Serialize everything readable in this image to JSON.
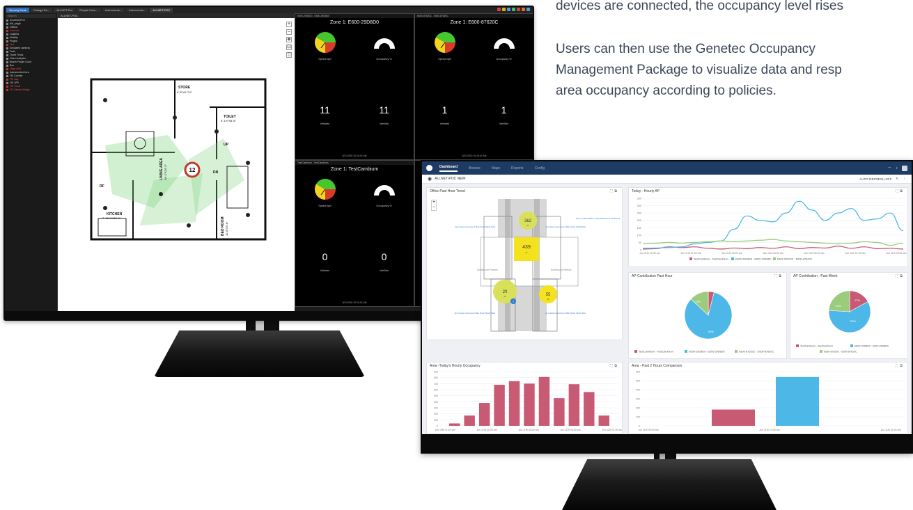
{
  "marketing": {
    "line1": "devices are connected, the occupancy level rises",
    "p2_line1": "Users can then use the Genetec Occupancy",
    "p2_line2": "Management Package to visualize data and resp",
    "p2_line3": "area occupancy according to policies."
  },
  "security_desk": {
    "tabs": [
      "Security Desk",
      "Change Re...",
      "ALLNET-Poc",
      "People Coun...",
      "Instruments...",
      "Instruments...",
      "ALLNET-POC"
    ],
    "tray_colors": [
      "#d94040",
      "#e0b000",
      "#4a9ee0",
      "#40c060",
      "#d94040",
      "#e07020",
      "#4a9ee0"
    ],
    "search_placeholder": "Search",
    "tree": [
      {
        "label": "SmartCityPOC",
        "red": false
      },
      {
        "label": "AM_plugin",
        "red": false
      },
      {
        "label": "Ottawa",
        "red": false
      },
      {
        "label": "Cameras",
        "red": true
      },
      {
        "label": "Logistics",
        "red": false
      },
      {
        "label": "Mobility",
        "red": false
      },
      {
        "label": "Plugins",
        "red": false
      },
      {
        "label": "Test",
        "red": true
      },
      {
        "label": "Simulated cameras",
        "red": false
      },
      {
        "label": "Tools",
        "red": false
      },
      {
        "label": "Travel Times",
        "red": false
      },
      {
        "label": "Video Analytics",
        "red": false
      },
      {
        "label": "Beach People Count",
        "red": false
      },
      {
        "label": "Bus",
        "red": false
      },
      {
        "label": "Other APN",
        "red": true
      },
      {
        "label": "Instrumented Area",
        "red": false
      },
      {
        "label": "TEI Corridor",
        "red": false
      },
      {
        "label": "TEI Italy",
        "red": true
      },
      {
        "label": "TEI LPR",
        "red": false
      },
      {
        "label": "TEI Oneal",
        "red": true
      },
      {
        "label": "TEI Saleem Bridge",
        "red": true
      }
    ],
    "map_header": "ALLNET-POC",
    "map_tools": [
      "+",
      "–",
      "◈",
      "⊡",
      "▯"
    ],
    "floorplan": {
      "store": "STORE",
      "store_dim": "6'-8\"X8'-7½\"",
      "toilet": "TOILET",
      "toilet_dim": "6'-1½\"X8'-8\"",
      "living": "LIVING AREA",
      "living_dim": "28'-2\"X15'-5\"",
      "kitchen": "KITCHEN",
      "kitchen_dim": "7'-10½\"X10'-2\"",
      "bedroom": "BED ROOM",
      "bedroom_dim": "11'-8\"X9'-8\"",
      "dn": "DN",
      "up": "UP",
      "rf": "RF",
      "count": "12"
    },
    "tiles": [
      {
        "head": "E600-29D8D0 - E600-29D8D0",
        "title": "Zone 1: E600-29D8D0",
        "speed_label": "Speed mph",
        "occ_label": "Occupancy %",
        "occ_value": "0",
        "left_num": "11",
        "left_label": "Vehicles",
        "right_num": "11",
        "right_label": "Veh/Min",
        "date": "6/11/2020 10:20:42 AM"
      },
      {
        "head": "E600-87620C - E600-87620C",
        "title": "Zone 1: E600-87620C",
        "speed_label": "Speed mph",
        "occ_label": "Occupancy %",
        "occ_value": "0",
        "left_num": "1",
        "left_label": "Vehicles",
        "right_num": "1",
        "right_label": "Veh/Min",
        "date": "6/11/2020 10:20:42 AM"
      },
      {
        "head": "TestCambium - TestCambium",
        "title": "Zone 1: TestCambium",
        "speed_label": "Speed mph",
        "occ_label": "Occupancy %",
        "occ_value": "0",
        "left_num": "0",
        "left_label": "Vehicles",
        "right_num": "0",
        "right_label": "Veh/Min",
        "date": "6/11/2020 10:20:42 AM"
      }
    ],
    "gauge_ticks": [
      "0",
      "100"
    ]
  },
  "dashboard": {
    "nav": {
      "tabs": [
        "Dashboard",
        "Browse",
        "Maps",
        "Reports",
        "Config"
      ],
      "active": "Dashboard"
    },
    "location": "ALLNET-POC NEW",
    "auto_refresh": "AUTO REFRESH OFF",
    "panels": {
      "office_trend": {
        "title": "Office Past Hour Trend",
        "bubbles": [
          "362",
          "439",
          "20",
          "55"
        ],
        "bubble_units": "%",
        "platform_left": "Southbound Platform",
        "platform_right": "Northbound Platform",
        "sign_tl": "Up to Fares Concourse & Main Street (North Side)",
        "sign_tr": "Up to Fares Concourse & Main Street (North Side)",
        "sign_far_right": "Down to Main-Eastlink Trains (Eastbound / Westbound)",
        "sign_bl": "Up to Fares Concourse & Main Street (South Side)",
        "sign_br": "Up to Fares Concourse & Main Street (South Side)",
        "info": "i"
      },
      "hourly_ap": {
        "title": "Today - Hourly AP"
      },
      "contrib_hour": {
        "title": "AP Contribution Past Hour"
      },
      "contrib_week": {
        "title": "AP Contribution - Past Week"
      },
      "area_hourly": {
        "title": "Area -Today's Hourly Occupancy"
      },
      "area_compare": {
        "title": "Area - Past 2 Hours Comparison"
      }
    }
  },
  "chart_data": [
    {
      "type": "line",
      "title": "Today - Hourly AP",
      "x_ticks": [
        "Jun 11th 12:00 am",
        "Jun 11th 01:30 am",
        "Jun 11th 03:00 am",
        "Jun 11th 04:30 am",
        "Jun 11th 06:00 am",
        "Jun 11th 07:30 am",
        "Jun 11th 09:00 am"
      ],
      "ylim": [
        0,
        350
      ],
      "y_ticks": [
        0,
        50,
        100,
        150,
        200,
        250,
        300,
        350
      ],
      "x_hours": [
        0,
        0.5,
        1,
        1.5,
        2,
        2.5,
        3,
        3.5,
        4,
        4.5,
        5,
        5.5,
        6,
        6.5,
        7,
        7.5,
        8,
        8.5,
        9,
        9.5,
        10
      ],
      "series": [
        {
          "name": "TestCambium - TestCambium",
          "color": "#c85a74",
          "values": [
            5,
            8,
            20,
            15,
            20,
            10,
            5,
            12,
            8,
            15,
            10,
            20,
            8,
            15,
            12,
            25,
            10,
            20,
            8,
            10,
            5
          ]
        },
        {
          "name": "E600-29D8D0 - E600-29D8D0",
          "color": "#4db8e8",
          "values": [
            10,
            12,
            15,
            20,
            40,
            50,
            60,
            140,
            230,
            200,
            190,
            250,
            330,
            270,
            200,
            250,
            280,
            200,
            210,
            250,
            130
          ]
        },
        {
          "name": "E600-87620C - E600-87620C",
          "color": "#9bcb7d",
          "values": [
            40,
            45,
            50,
            45,
            50,
            55,
            60,
            55,
            60,
            65,
            70,
            60,
            55,
            50,
            45,
            40,
            45,
            55,
            50,
            30,
            45
          ]
        }
      ],
      "legend": "bottom"
    },
    {
      "type": "pie",
      "title": "AP Contribution Past Hour",
      "slices": [
        {
          "name": "TestCambium - TestCambium",
          "value": 4,
          "color": "#c85a74"
        },
        {
          "name": "E600-29D8D0 - E600-29D8D0",
          "value": 83,
          "color": "#4db8e8"
        },
        {
          "name": "E600-87620C - E600-87620C",
          "value": 13,
          "color": "#9bcb7d"
        }
      ],
      "labels": [
        "13%",
        "83%"
      ],
      "legend": "bottom"
    },
    {
      "type": "pie",
      "title": "AP Contribution - Past Week",
      "slices": [
        {
          "name": "TestCambium - TestCambium",
          "value": 17,
          "color": "#c85a74"
        },
        {
          "name": "E600-29D8D0 - E600-29D8D0",
          "value": 59,
          "color": "#4db8e8"
        },
        {
          "name": "E600-87620C - E600-87620C",
          "value": 24,
          "color": "#9bcb7d"
        }
      ],
      "labels": [
        "17%",
        "24%",
        "59%"
      ],
      "legend": "bottom"
    },
    {
      "type": "bar",
      "title": "Area -Today's Hourly Occupancy",
      "color": "#c85a74",
      "values": [
        40,
        170,
        380,
        680,
        740,
        700,
        810,
        460,
        690,
        560,
        170
      ],
      "x_ticks": [
        "Jun 10th 11:00 pm",
        "Jun 11th 02:00 am",
        "Jun 11th 05:00 am",
        "Jun 11th 08:00 am",
        "Jun 11th 11:00 am"
      ],
      "ylim": [
        0,
        900
      ],
      "y_ticks": [
        0,
        100,
        200,
        300,
        400,
        500,
        600,
        700,
        800,
        900
      ]
    },
    {
      "type": "bar",
      "title": "Area - Past 2 Hours Comparison",
      "categories": [
        "Jun 11th 09:00 am",
        "Jun 11th 10:00 am"
      ],
      "series": [
        {
          "values": [
            180,
            0
          ],
          "color": "#c85a74"
        },
        {
          "values": [
            0,
            540
          ],
          "color": "#4db8e8"
        }
      ],
      "x_ticks": [
        "Jun 11th 09:00 am",
        "Jun 11th 10:00 am",
        "Jun 11th 11:00 am"
      ],
      "ylim": [
        0,
        600
      ],
      "y_ticks": [
        0,
        100,
        200,
        300,
        400,
        500,
        600
      ]
    }
  ]
}
